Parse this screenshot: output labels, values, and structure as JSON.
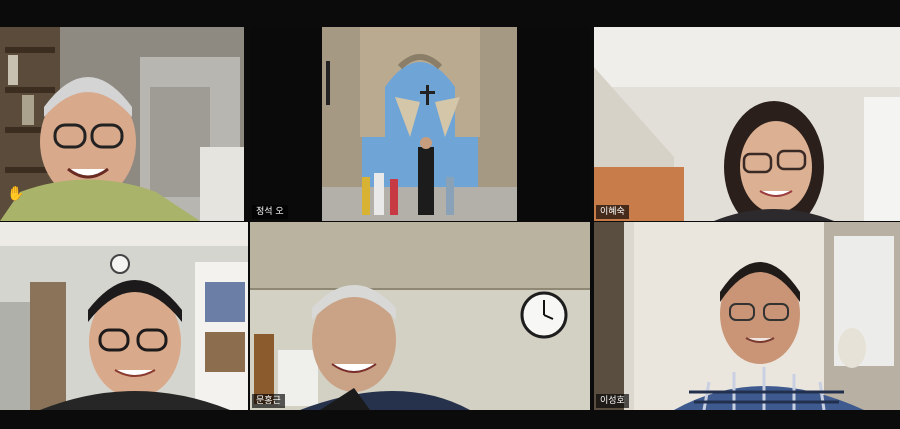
{
  "participants": [
    {
      "name": "",
      "active": false
    },
    {
      "name": "정석 오",
      "active": false
    },
    {
      "name": "이혜숙",
      "active": false
    },
    {
      "name": "",
      "active": false
    },
    {
      "name": "문홍근",
      "active": true
    },
    {
      "name": "이성호",
      "active": false
    }
  ],
  "icons": {
    "raise_hand": "raised-hand-icon"
  },
  "colors": {
    "active_speaker_border": "#d8e63a",
    "background": "#0b0b0c"
  }
}
